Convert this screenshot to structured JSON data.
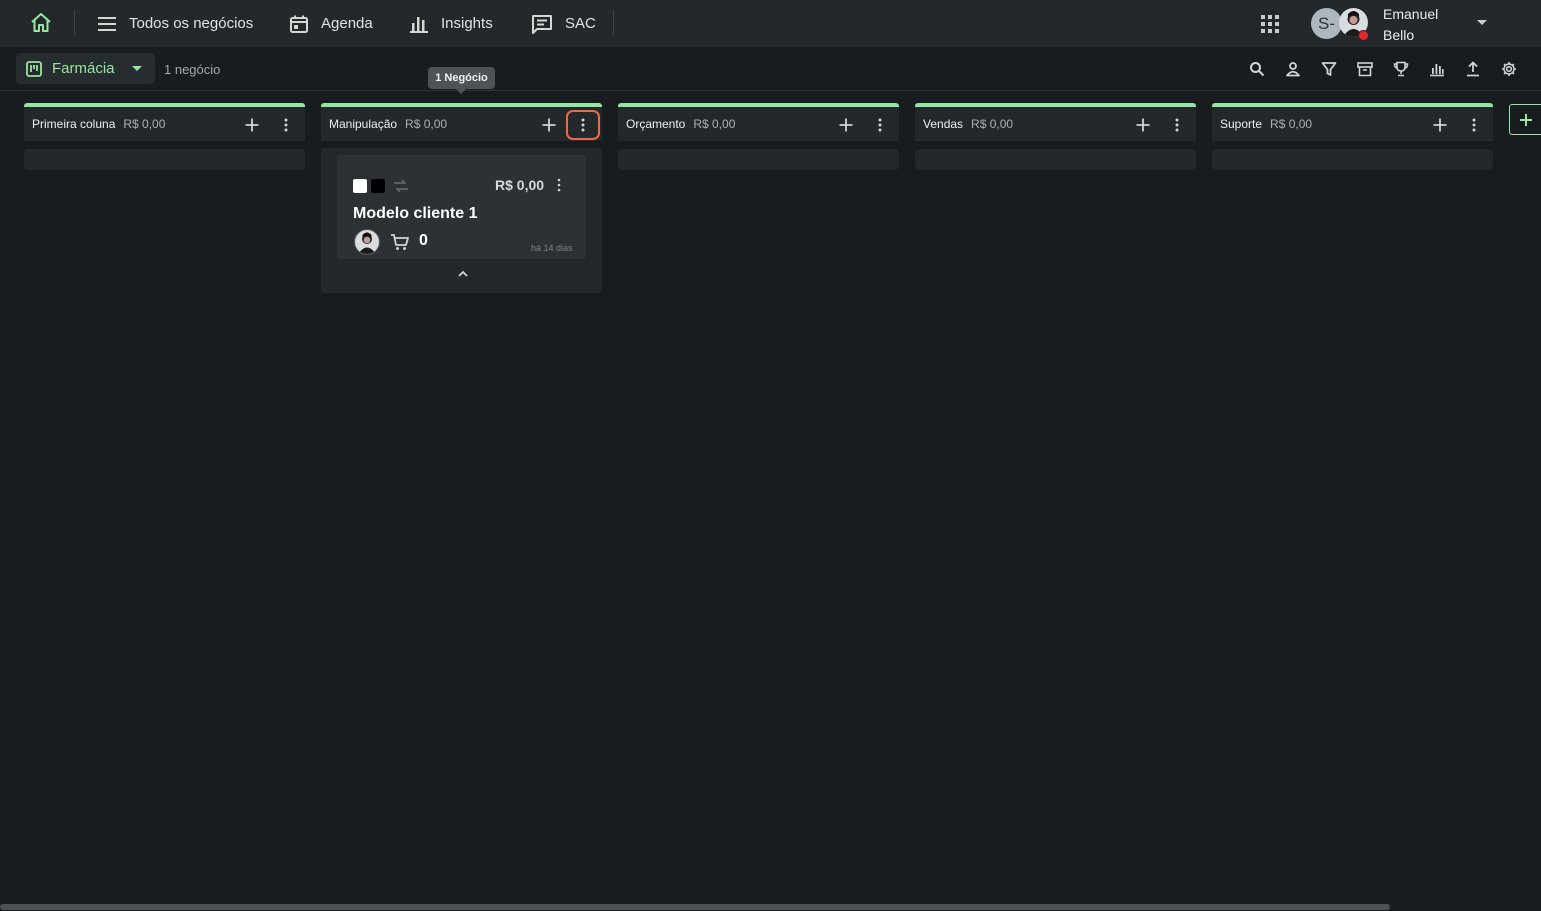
{
  "topnav": {
    "items": [
      {
        "label": "Todos os negócios",
        "icon": "menu-lines-icon"
      },
      {
        "label": "Agenda",
        "icon": "calendar-icon"
      },
      {
        "label": "Insights",
        "icon": "bar-chart-icon"
      },
      {
        "label": "SAC",
        "icon": "message-icon"
      }
    ],
    "user": {
      "initial": "S-",
      "first_name": "Emanuel",
      "last_name": "Bello",
      "status_color": "#e3262b"
    }
  },
  "subbar": {
    "pipeline": "Farmácia",
    "deal_count": "1 negócio",
    "tools": [
      "search-icon",
      "person-icon",
      "filter-icon",
      "archive-icon",
      "trophy-icon",
      "chart-icon",
      "upload-icon",
      "gear-icon"
    ]
  },
  "tooltip": "1 Negócio",
  "columns": [
    {
      "title": "Primeira coluna",
      "amount": "R$ 0,00"
    },
    {
      "title": "Manipulação",
      "amount": "R$ 0,00"
    },
    {
      "title": "Orçamento",
      "amount": "R$ 0,00"
    },
    {
      "title": "Vendas",
      "amount": "R$ 0,00"
    },
    {
      "title": "Suporte",
      "amount": "R$ 0,00"
    }
  ],
  "card": {
    "amount": "R$ 0,00",
    "title": "Modelo cliente 1",
    "cart_count": "0",
    "time": "há 14 dias",
    "tags": [
      "#ffffff",
      "#000000"
    ]
  },
  "colors": {
    "accent": "#93e6a3",
    "highlight": "#f06a45"
  }
}
